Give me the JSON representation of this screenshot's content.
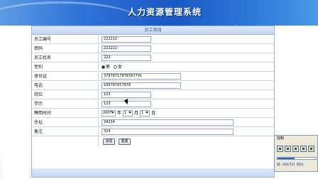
{
  "banner": {
    "title": "人力资源管理系统"
  },
  "form": {
    "header": "员工添加",
    "fields": [
      {
        "label": "员工编号",
        "value": "222222"
      },
      {
        "label": "密码",
        "value": "222222"
      },
      {
        "label": "员工姓名",
        "value": "222"
      },
      {
        "label": "性别"
      },
      {
        "label": "身份证",
        "value": "37878717878787791"
      },
      {
        "label": "电话",
        "value": "189787657678"
      },
      {
        "label": "岗位",
        "value": "123"
      },
      {
        "label": "学历",
        "value": "123"
      },
      {
        "label": "聘用时间"
      },
      {
        "label": "住址",
        "value": "34234"
      },
      {
        "label": "备注",
        "value": "324"
      }
    ],
    "gender": {
      "male": "男",
      "female": "女",
      "selected": "male"
    },
    "hire_date": {
      "year": "2007",
      "year_unit": "年",
      "month": "1",
      "month_unit": "月",
      "day": "1",
      "day_unit": "日"
    },
    "buttons": {
      "add": "添加",
      "reset": "重置"
    }
  },
  "control_panel": {
    "title": "控制",
    "status": "帧: 308/701 时间:",
    "progress": 0.44
  },
  "colors": {
    "banner": "#1a58c4",
    "panel_border": "#9fb4d9",
    "header_text": "#2c5aa6"
  }
}
